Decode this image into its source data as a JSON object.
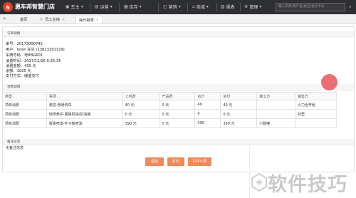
{
  "topbar": {
    "logo_text": "车",
    "brand": "惠车邦智慧门店",
    "nav": [
      {
        "icon": "car-icon",
        "label": "车主"
      },
      {
        "icon": "chart-icon",
        "label": "运营"
      },
      {
        "icon": "box-icon",
        "label": "库存"
      },
      {
        "icon": "wallet-icon",
        "label": "营销"
      },
      {
        "icon": "shop-icon",
        "label": "商城"
      },
      {
        "icon": "report-icon",
        "label": "报表"
      },
      {
        "icon": "gear-icon",
        "label": "管理"
      }
    ],
    "search_placeholder": "输入车牌/用户名/姓名/会员卡号"
  },
  "tabs": {
    "collapse_glyph": "»",
    "items": [
      {
        "label": "首页",
        "closable": false
      },
      {
        "label": "员工业绩",
        "closable": true
      },
      {
        "label": "操作报表",
        "closable": true
      }
    ]
  },
  "order": {
    "section_title": "订单详情",
    "lines": [
      {
        "label": "单号：",
        "value": "20173000745"
      },
      {
        "label": "用户：",
        "value": "loren 先生 (13823291329)"
      },
      {
        "label": "车牌号码：",
        "value": "粤BBG601"
      },
      {
        "label": "消费时间：",
        "value": "2017/12/26 0:35:35"
      },
      {
        "label": "消费金额：",
        "value": "430 元"
      },
      {
        "label": "余额：",
        "value": "1020 元"
      },
      {
        "label": "支付方式：",
        "value": "储值支付"
      }
    ]
  },
  "consumption": {
    "section_title": "消费详情",
    "columns": [
      "类型",
      "事项",
      "工时费",
      "产品费",
      "合计",
      "实付",
      "施工方",
      "销售方"
    ],
    "rows": [
      [
        "项目消费",
        "美容-普通洗车",
        "40 元",
        "0 元",
        "40",
        "40 元",
        "",
        "火力全开组"
      ],
      [
        "项目消费",
        "快修养护-更换机油/机油格",
        "0 元",
        "0 元",
        "0",
        "0 元",
        "",
        "孙里"
      ],
      [
        "项目消费",
        "钣金喷漆-叶子板喷漆",
        "390 元",
        "0 元",
        "390",
        "390 元",
        "小腊嘟",
        ""
      ]
    ]
  },
  "remarks": {
    "section_title": "备注信息",
    "text": "无备注信息"
  },
  "actions": {
    "back": "返回",
    "print": "打印",
    "print_small": "打印小票"
  },
  "watermark": {
    "text": "软件技巧"
  },
  "colors": {
    "topbar": "#2e2f33",
    "accent": "#ef8a5a",
    "logo": "#e33c2a",
    "cursor_highlight": "#e84650"
  }
}
